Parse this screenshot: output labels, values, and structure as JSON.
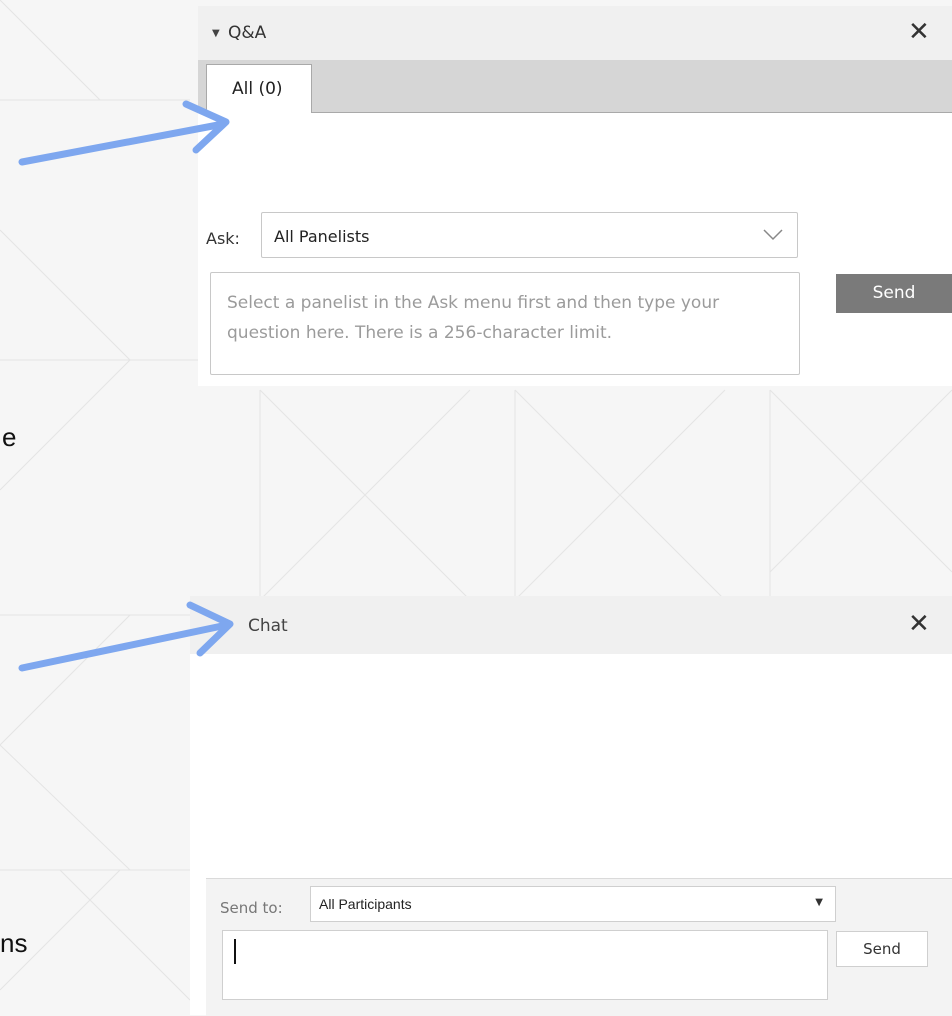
{
  "background": {
    "color": "#f6f6f6",
    "line_color": "#e2e2e2"
  },
  "edge_fragments": [
    "e",
    "ns"
  ],
  "qa": {
    "title": "Q&A",
    "close_glyph": "✕",
    "tabs": [
      {
        "label": "All (0)",
        "active": true
      }
    ],
    "ask_label": "Ask:",
    "ask_selected": "All Panelists",
    "question_placeholder": "Select a panelist in the Ask menu first and then type your question here. There is a 256-character limit.",
    "send_label": "Send"
  },
  "chat": {
    "title": "Chat",
    "close_glyph": "✕",
    "send_to_label": "Send to:",
    "send_to_selected": "All Participants",
    "message_value": "",
    "send_label": "Send"
  },
  "annotations": {
    "arrow_color": "#7ea7ef"
  },
  "icons": {
    "collapse": "caret-down-icon",
    "close": "close-icon",
    "dropdown": "chevron-down-icon",
    "annotation": "arrow-icon"
  }
}
